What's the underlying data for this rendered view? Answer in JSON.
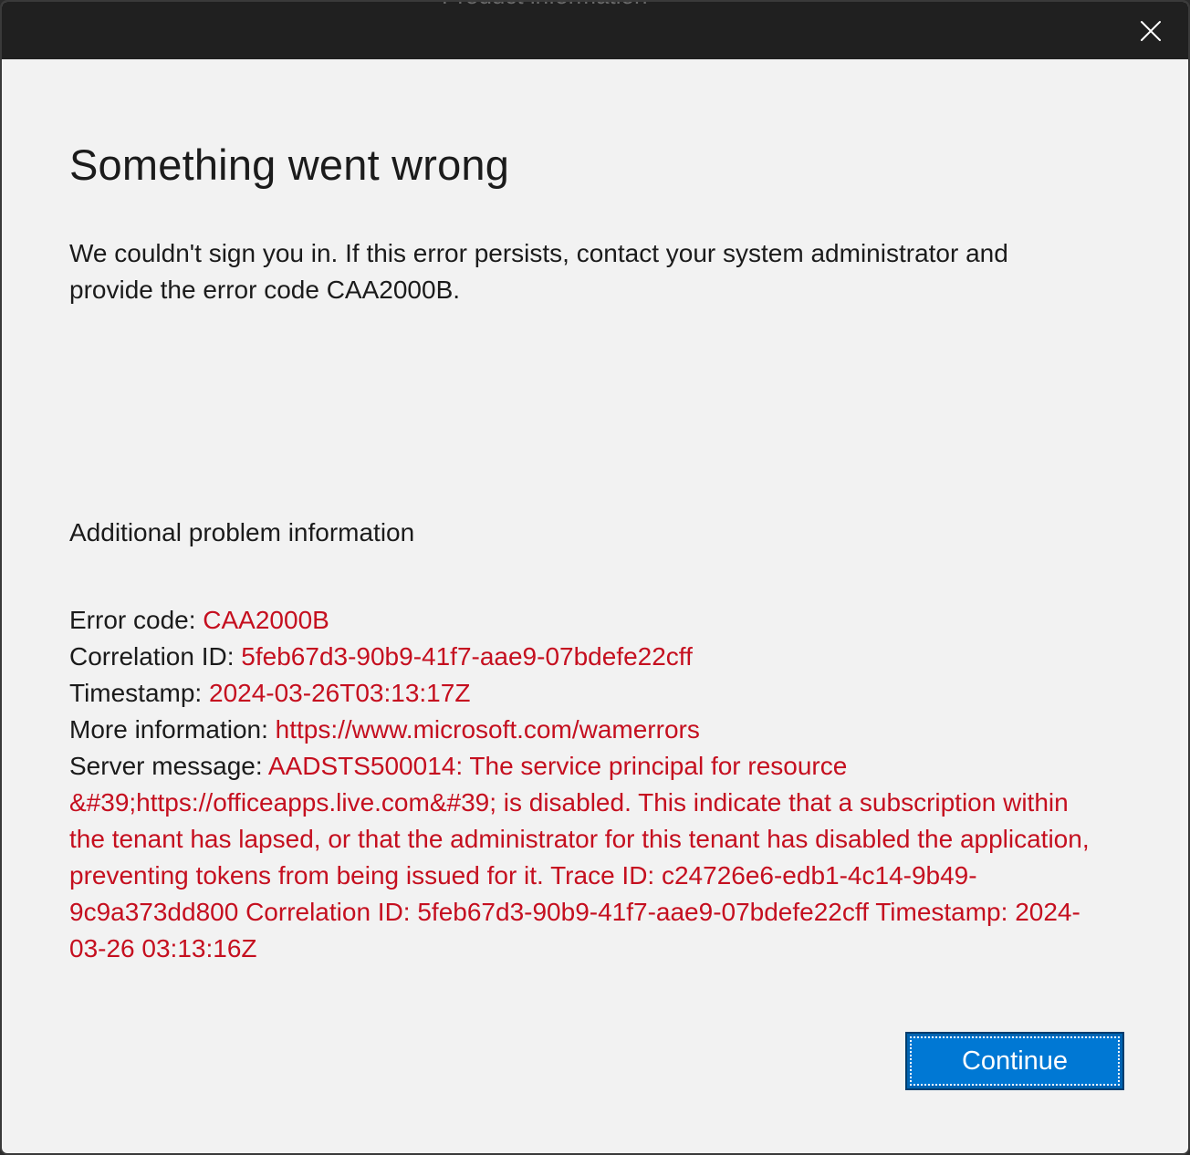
{
  "window": {
    "title_partial": "Product information"
  },
  "dialog": {
    "title": "Something went wrong",
    "description": "We couldn't sign you in. If this error persists, contact your system administrator and provide the error code CAA2000B.",
    "additional_heading": "Additional problem information",
    "fields": [
      {
        "label": "Error code: ",
        "value": "CAA2000B"
      },
      {
        "label": "Correlation ID: ",
        "value": "5feb67d3-90b9-41f7-aae9-07bdefe22cff"
      },
      {
        "label": "Timestamp: ",
        "value": "2024-03-26T03:13:17Z"
      },
      {
        "label": "More information: ",
        "value": "https://www.microsoft.com/wamerrors"
      },
      {
        "label": "Server message: ",
        "value": "AADSTS500014: The service principal for resource &#39;https://officeapps.live.com&#39; is disabled. This indicate that a subscription within the tenant has lapsed, or that the administrator for this tenant has disabled the application, preventing tokens from being issued for it. Trace ID: c24726e6-edb1-4c14-9b49-9c9a373dd800 Correlation ID: 5feb67d3-90b9-41f7-aae9-07bdefe22cff Timestamp: 2024-03-26 03:13:16Z"
      }
    ],
    "continue_label": "Continue"
  },
  "colors": {
    "error_value": "#c50f1f",
    "accent": "#0078d4",
    "titlebar": "#202020",
    "background": "#f2f2f2"
  },
  "icons": {
    "close": "close-icon"
  }
}
